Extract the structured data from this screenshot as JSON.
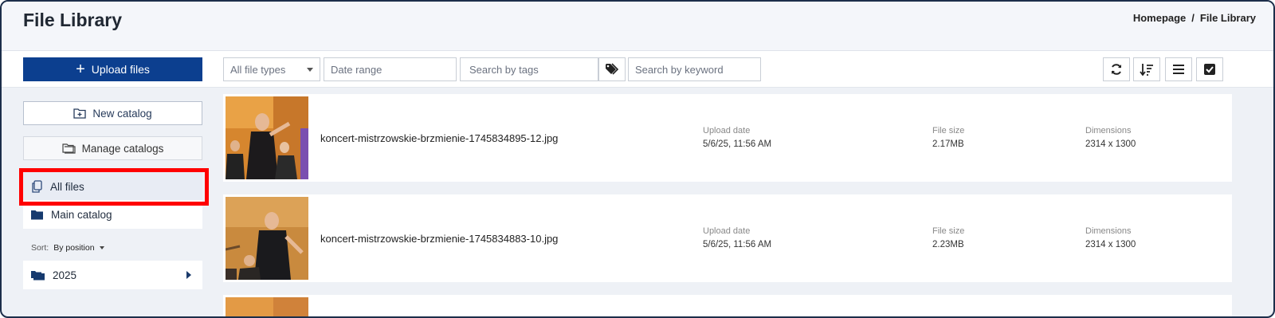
{
  "header": {
    "title": "File Library",
    "breadcrumb": [
      "Homepage",
      "File Library"
    ],
    "separator": "/"
  },
  "toolbar": {
    "upload_label": "Upload files",
    "file_types": "All file types",
    "date_range_placeholder": "Date range",
    "tags_placeholder": "Search by tags",
    "keyword_placeholder": "Search by keyword",
    "icons": [
      "refresh-icon",
      "sort-icon",
      "list-view-icon",
      "select-all-checkbox-icon"
    ]
  },
  "sidebar": {
    "new_catalog": "New catalog",
    "manage_catalogs": "Manage catalogs",
    "items": [
      {
        "label": "All files",
        "icon": "copy-files-icon",
        "active": true
      },
      {
        "label": "Main catalog",
        "icon": "folder-icon",
        "active": false
      }
    ],
    "sort": {
      "label": "Sort:",
      "value": "By position"
    },
    "folders": [
      {
        "label": "2025",
        "icon": "folders-icon"
      }
    ]
  },
  "files": [
    {
      "name": "koncert-mistrzowskie-brzmienie-1745834895-12.jpg",
      "upload_label": "Upload date",
      "upload_date": "5/6/25, 11:56 AM",
      "size_label": "File size",
      "size": "2.17MB",
      "dim_label": "Dimensions",
      "dimensions": "2314 x 1300"
    },
    {
      "name": "koncert-mistrzowskie-brzmienie-1745834883-10.jpg",
      "upload_label": "Upload date",
      "upload_date": "5/6/25, 11:56 AM",
      "size_label": "File size",
      "size": "2.23MB",
      "dim_label": "Dimensions",
      "dimensions": "2314 x 1300"
    }
  ],
  "colors": {
    "primary": "#0c3f8f",
    "highlight": "#ff0000",
    "background": "#eef1f6"
  }
}
